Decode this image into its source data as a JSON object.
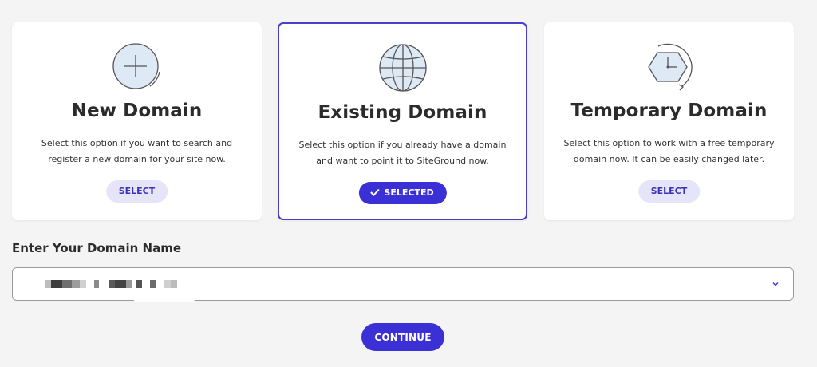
{
  "options": [
    {
      "title": "New Domain",
      "description": "Select this option if you want to search and register a new domain for your site now.",
      "button_label": "SELECT",
      "icon": "plus-circle-icon"
    },
    {
      "title": "Existing Domain",
      "description": "Select this option if you already have a domain and want to point it to SiteGround now.",
      "button_label": "SELECTED",
      "icon": "globe-icon"
    },
    {
      "title": "Temporary Domain",
      "description": "Select this option to work with a free temporary domain now. It can be easily changed later.",
      "button_label": "SELECT",
      "icon": "clock-icon"
    }
  ],
  "domain_input": {
    "label": "Enter Your Domain Name",
    "value": ""
  },
  "continue_label": "CONTINUE",
  "colors": {
    "accent": "#3b2fd6",
    "selected_border": "#4b40c8",
    "select_button_bg": "#e6e4f8",
    "icon_fill": "#dde9f5"
  }
}
